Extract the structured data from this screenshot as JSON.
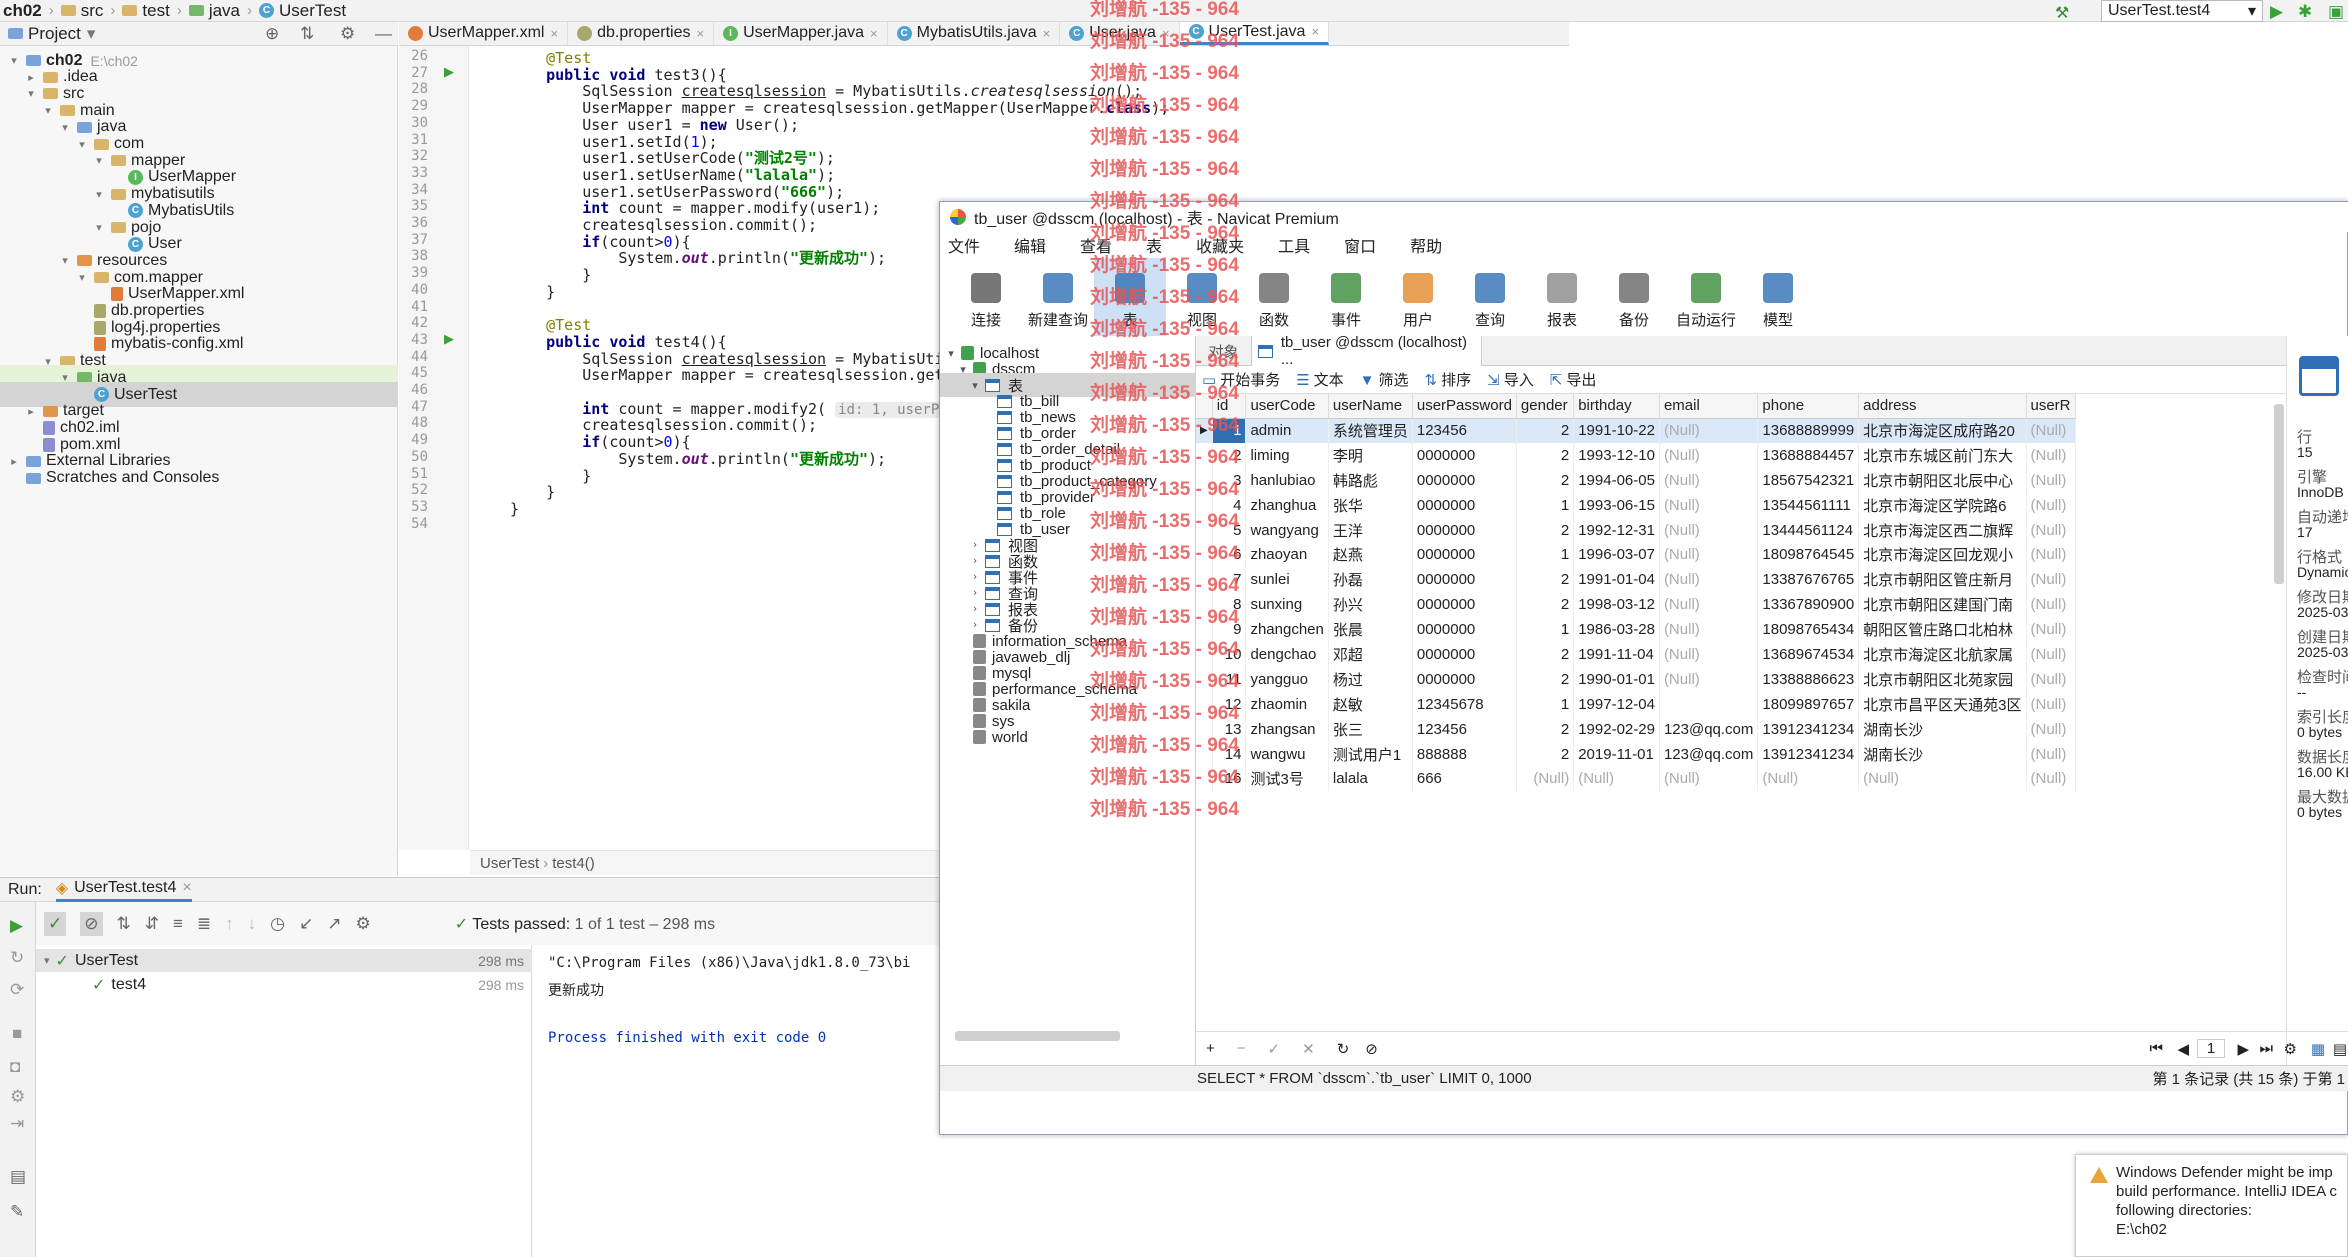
{
  "ide": {
    "breadcrumb": [
      "ch02",
      "src",
      "test",
      "java",
      "UserTest"
    ],
    "run_config": "UserTest.test4",
    "project_label": "Project",
    "tree": [
      {
        "label": "ch02",
        "path": "E:\\ch02",
        "level": 0,
        "type": "module"
      },
      {
        "label": ".idea",
        "level": 1,
        "type": "folder"
      },
      {
        "label": "src",
        "level": 1,
        "type": "folder"
      },
      {
        "label": "main",
        "level": 2,
        "type": "folder"
      },
      {
        "label": "java",
        "level": 3,
        "type": "src"
      },
      {
        "label": "com",
        "level": 4,
        "type": "folder"
      },
      {
        "label": "mapper",
        "level": 5,
        "type": "folder"
      },
      {
        "label": "UserMapper",
        "level": 6,
        "type": "interface"
      },
      {
        "label": "mybatisutils",
        "level": 5,
        "type": "folder"
      },
      {
        "label": "MybatisUtils",
        "level": 6,
        "type": "class"
      },
      {
        "label": "pojo",
        "level": 5,
        "type": "folder"
      },
      {
        "label": "User",
        "level": 6,
        "type": "class"
      },
      {
        "label": "resources",
        "level": 3,
        "type": "res"
      },
      {
        "label": "com.mapper",
        "level": 4,
        "type": "folder"
      },
      {
        "label": "UserMapper.xml",
        "level": 5,
        "type": "xml"
      },
      {
        "label": "db.properties",
        "level": 4,
        "type": "prop"
      },
      {
        "label": "log4j.properties",
        "level": 4,
        "type": "prop"
      },
      {
        "label": "mybatis-config.xml",
        "level": 4,
        "type": "xml"
      },
      {
        "label": "test",
        "level": 2,
        "type": "folder"
      },
      {
        "label": "java",
        "level": 3,
        "type": "test"
      },
      {
        "label": "UserTest",
        "level": 4,
        "type": "class"
      },
      {
        "label": "target",
        "level": 1,
        "type": "target"
      },
      {
        "label": "ch02.iml",
        "level": 1,
        "type": "file"
      },
      {
        "label": "pom.xml",
        "level": 1,
        "type": "file"
      },
      {
        "label": "External Libraries",
        "level": 0,
        "type": "lib"
      },
      {
        "label": "Scratches and Consoles",
        "level": 0,
        "type": "lib"
      }
    ],
    "tabs": [
      "UserMapper.xml",
      "db.properties",
      "UserMapper.java",
      "MybatisUtils.java",
      "User.java",
      "UserTest.java"
    ],
    "line_numbers": [
      "26",
      "27",
      "28",
      "29",
      "30",
      "31",
      "32",
      "33",
      "34",
      "35",
      "36",
      "37",
      "38",
      "39",
      "40",
      "41",
      "42",
      "43",
      "44",
      "45",
      "46",
      "47",
      "48",
      "49",
      "50",
      "51",
      "52",
      "53",
      "54"
    ],
    "code_crumb": [
      "UserTest",
      "test4()"
    ],
    "run_label": "Run:",
    "run_tab": "UserTest.test4",
    "tests_passed": "Tests passed:",
    "tests_count": "1 of 1 test – 298 ms",
    "test_root": "UserTest",
    "test_root_time": "298 ms",
    "test_child": "test4",
    "test_child_time": "298 ms",
    "console": [
      "\"C:\\Program Files (x86)\\Java\\jdk1.8.0_73\\bi",
      "更新成功",
      "",
      "Process finished with exit code 0"
    ]
  },
  "navicat": {
    "title": "tb_user @dsscm (localhost) - 表 - Navicat Premium",
    "menu": [
      "文件",
      "编辑",
      "查看",
      "表",
      "收藏夹",
      "工具",
      "窗口",
      "帮助"
    ],
    "toolbar": [
      "连接",
      "新建查询",
      "表",
      "视图",
      "函数",
      "事件",
      "用户",
      "查询",
      "报表",
      "备份",
      "自动运行",
      "模型"
    ],
    "tree": [
      {
        "label": "localhost",
        "level": 0
      },
      {
        "label": "dsscm",
        "level": 1
      },
      {
        "label": "表",
        "level": 2
      },
      {
        "label": "tb_bill",
        "level": 3
      },
      {
        "label": "tb_news",
        "level": 3
      },
      {
        "label": "tb_order",
        "level": 3
      },
      {
        "label": "tb_order_detail",
        "level": 3
      },
      {
        "label": "tb_product",
        "level": 3
      },
      {
        "label": "tb_product_category",
        "level": 3
      },
      {
        "label": "tb_provider",
        "level": 3
      },
      {
        "label": "tb_role",
        "level": 3
      },
      {
        "label": "tb_user",
        "level": 3
      },
      {
        "label": "视图",
        "level": 2
      },
      {
        "label": "函数",
        "level": 2
      },
      {
        "label": "事件",
        "level": 2
      },
      {
        "label": "查询",
        "level": 2
      },
      {
        "label": "报表",
        "level": 2
      },
      {
        "label": "备份",
        "level": 2
      },
      {
        "label": "information_schema",
        "level": 1
      },
      {
        "label": "javaweb_dlj",
        "level": 1
      },
      {
        "label": "mysql",
        "level": 1
      },
      {
        "label": "performance_schema",
        "level": 1
      },
      {
        "label": "sakila",
        "level": 1
      },
      {
        "label": "sys",
        "level": 1
      },
      {
        "label": "world",
        "level": 1
      }
    ],
    "obj_tab": "对象",
    "table_tab": "tb_user @dsscm (localhost) ...",
    "subtools": [
      "开始事务",
      "文本",
      "筛选",
      "排序",
      "导入",
      "导出"
    ],
    "columns": [
      "id",
      "userCode",
      "userName",
      "userPassword",
      "gender",
      "birthday",
      "email",
      "phone",
      "address",
      "userR"
    ],
    "rows": [
      [
        "1",
        "admin",
        "系统管理员",
        "123456",
        "2",
        "1991-10-22",
        "(Null)",
        "13688889999",
        "北京市海淀区成府路20",
        "(Null)"
      ],
      [
        "2",
        "liming",
        "李明",
        "0000000",
        "2",
        "1993-12-10",
        "(Null)",
        "13688884457",
        "北京市东城区前门东大",
        "(Null)"
      ],
      [
        "3",
        "hanlubiao",
        "韩路彪",
        "0000000",
        "2",
        "1994-06-05",
        "(Null)",
        "18567542321",
        "北京市朝阳区北辰中心",
        "(Null)"
      ],
      [
        "4",
        "zhanghua",
        "张华",
        "0000000",
        "1",
        "1993-06-15",
        "(Null)",
        "13544561111",
        "北京市海淀区学院路6",
        "(Null)"
      ],
      [
        "5",
        "wangyang",
        "王洋",
        "0000000",
        "2",
        "1992-12-31",
        "(Null)",
        "13444561124",
        "北京市海淀区西二旗辉",
        "(Null)"
      ],
      [
        "6",
        "zhaoyan",
        "赵燕",
        "0000000",
        "1",
        "1996-03-07",
        "(Null)",
        "18098764545",
        "北京市海淀区回龙观小",
        "(Null)"
      ],
      [
        "7",
        "sunlei",
        "孙磊",
        "0000000",
        "2",
        "1991-01-04",
        "(Null)",
        "13387676765",
        "北京市朝阳区管庄新月",
        "(Null)"
      ],
      [
        "8",
        "sunxing",
        "孙兴",
        "0000000",
        "2",
        "1998-03-12",
        "(Null)",
        "13367890900",
        "北京市朝阳区建国门南",
        "(Null)"
      ],
      [
        "9",
        "zhangchen",
        "张晨",
        "0000000",
        "1",
        "1986-03-28",
        "(Null)",
        "18098765434",
        "朝阳区管庄路口北柏林",
        "(Null)"
      ],
      [
        "10",
        "dengchao",
        "邓超",
        "0000000",
        "2",
        "1991-11-04",
        "(Null)",
        "13689674534",
        "北京市海淀区北航家属",
        "(Null)"
      ],
      [
        "11",
        "yangguo",
        "杨过",
        "0000000",
        "2",
        "1990-01-01",
        "(Null)",
        "13388886623",
        "北京市朝阳区北苑家园",
        "(Null)"
      ],
      [
        "12",
        "zhaomin",
        "赵敏",
        "12345678",
        "1",
        "1997-12-04",
        "",
        "18099897657",
        "北京市昌平区天通苑3区",
        "(Null)"
      ],
      [
        "13",
        "zhangsan",
        "张三",
        "123456",
        "2",
        "1992-02-29",
        "123@qq.com",
        "13912341234",
        "湖南长沙",
        "(Null)"
      ],
      [
        "14",
        "wangwu",
        "测试用户1",
        "888888",
        "2",
        "2019-11-01",
        "123@qq.com",
        "13912341234",
        "湖南长沙",
        "(Null)"
      ],
      [
        "16",
        "测试3号",
        "lalala",
        "666",
        "(Null)",
        "(Null)",
        "(Null)",
        "(Null)",
        "(Null)",
        "(Null)"
      ]
    ],
    "right_panel": [
      [
        "行",
        "15"
      ],
      [
        "引擎",
        "InnoDB"
      ],
      [
        "自动递增",
        "17"
      ],
      [
        "行格式",
        "Dynamic"
      ],
      [
        "修改日期",
        "2025-03"
      ],
      [
        "创建日期",
        "2025-03"
      ],
      [
        "检查时间",
        "--"
      ],
      [
        "索引长度",
        "0 bytes"
      ],
      [
        "数据长度",
        "16.00 KB"
      ],
      [
        "最大数据",
        "0 bytes"
      ]
    ],
    "page_number": "1",
    "sql": "SELECT * FROM `dsscm`.`tb_user` LIMIT 0, 1000",
    "record_info": "第 1 条记录 (共 15 条) 于第 1"
  },
  "watermark": "刘增航 -135 - 964",
  "defender": [
    "Windows Defender might be imp",
    "build performance. IntelliJ IDEA c",
    "following directories:",
    "E:\\ch02"
  ]
}
